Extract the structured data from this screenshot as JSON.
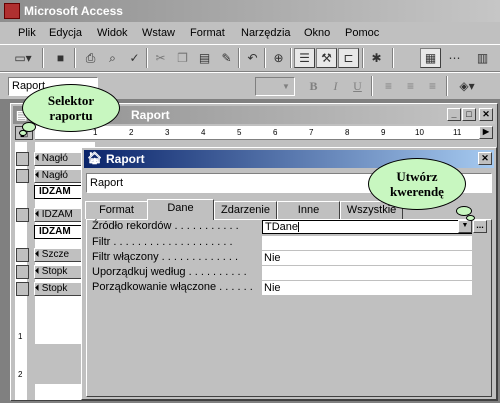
{
  "app": {
    "title": "Microsoft Access"
  },
  "menu": [
    "Plik",
    "Edycja",
    "Widok",
    "Wstaw",
    "Format",
    "Narzędzia",
    "Okno",
    "Pomoc"
  ],
  "format_bar": {
    "object_box": "Raport",
    "bold": "B",
    "italic": "I",
    "underline": "U"
  },
  "report_window": {
    "title": "Raport"
  },
  "ruler": {
    "labels": [
      "1",
      "2",
      "3",
      "4",
      "5",
      "6",
      "7",
      "8",
      "9",
      "10",
      "11"
    ]
  },
  "sections": {
    "header1": "Nagłó",
    "header2": "Nagłó",
    "field1": "IDZAM",
    "group_header": "IDZAM",
    "field2": "IDZAM",
    "detail": "Szcze",
    "footer1": "Stopk",
    "footer2": "Stopk"
  },
  "vruler": {
    "labels": [
      "1",
      "2"
    ]
  },
  "properties": {
    "title": "Raport",
    "object_select": "Raport",
    "tabs": [
      "Format",
      "Dane",
      "Zdarzenie",
      "Inne",
      "Wszystkie"
    ],
    "active_tab": "Dane",
    "rows": [
      {
        "label": "Źródło rekordów . . . . . . . . . . .",
        "value": "TDane"
      },
      {
        "label": "Filtr . . . . . . . . . . . . . . . . . . . .",
        "value": ""
      },
      {
        "label": "Filtr włączony . . . . . . . . . . . . .",
        "value": "Nie"
      },
      {
        "label": "Uporządkuj według . . . . . . . . . .",
        "value": ""
      },
      {
        "label": "Porządkowanie włączone . . . . . .",
        "value": "Nie"
      }
    ],
    "builder_button": "..."
  },
  "callouts": {
    "report_selector": "Selektor raportu",
    "build_query": "Utwórz kwerendę"
  },
  "colors": {
    "callout_fill": "#c8f7c0",
    "active_title": "#0a246a",
    "inactive_title": "#8e8e8e"
  }
}
